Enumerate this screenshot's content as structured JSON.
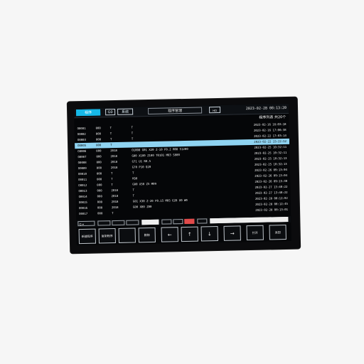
{
  "titlebar": {
    "tab_active": "程序",
    "tab_1": "G0",
    "tab_2": "系统",
    "title": "程序管理",
    "button": "HD",
    "clock": "2023-02-28 08:13:20"
  },
  "subheader": "程序列表  共20个",
  "rows": [
    {
      "c1": "O0001",
      "c2": "000",
      "c3": "T",
      "c4": "T",
      "c5": "2023-02-16 16:03:18",
      "selected": false
    },
    {
      "c1": "O0002",
      "c2": "000",
      "c3": "T",
      "c4": "T",
      "c5": "2023-02-16 17:06:38",
      "selected": false
    },
    {
      "c1": "O0003",
      "c2": "000",
      "c3": "T",
      "c4": "T",
      "c5": "2023-02-22 17:03:14",
      "selected": false
    },
    {
      "c1": "O0005",
      "c2": "000",
      "c3": "T",
      "c4": "",
      "c5": "2023-02-22 15:22:52",
      "selected": true
    },
    {
      "c1": "O0006",
      "c2": "000",
      "c3": "2018",
      "c4": "O1000 G01 X20 Z-10 F0.2 M08 S1200",
      "c5": "2023-02-25 10:32:11",
      "selected": false
    },
    {
      "c1": "O0007",
      "c2": "000",
      "c3": "2018",
      "c4": "G00 X100 Z100 T0101 M03 S800",
      "c5": "2023-02-25 10:32:11",
      "selected": false
    },
    {
      "c1": "O0008",
      "c2": "000",
      "c3": "2018",
      "c4": "G71 U1 R0.5",
      "c5": "2023-02-25 10:32:13",
      "selected": false
    },
    {
      "c1": "O0009",
      "c2": "000",
      "c3": "2018",
      "c4": "G70 P10 Q20",
      "c5": "2023-02-25 10:32:13",
      "selected": false
    },
    {
      "c1": "O0010",
      "c2": "000",
      "c3": "T",
      "c4": "T",
      "c5": "2023-02-26 09:13:04",
      "selected": false
    },
    {
      "c1": "O0011",
      "c2": "000",
      "c3": "T",
      "c4": "M30",
      "c5": "2023-02-26 09:13:04",
      "selected": false
    },
    {
      "c1": "O0012",
      "c2": "000",
      "c3": "T",
      "c4": "G00 X50 Z5 M09",
      "c5": "2023-02-26 09:15:30",
      "selected": false
    },
    {
      "c1": "O0013",
      "c2": "000",
      "c3": "2018",
      "c4": "T",
      "c5": "2023-02-27 13:40:22",
      "selected": false
    },
    {
      "c1": "O0014",
      "c2": "000",
      "c3": "2018",
      "c4": "T",
      "c5": "2023-02-27 13:40:22",
      "selected": false
    },
    {
      "c1": "O0015",
      "c2": "000",
      "c3": "2018",
      "c4": "G01 X30 Z-20 F0.15 M05 G28 U0 W0",
      "c5": "2023-02-28 08:12:02",
      "selected": false
    },
    {
      "c1": "O0016",
      "c2": "000",
      "c3": "2018",
      "c4": "G00 X80 Z80",
      "c5": "2023-02-28 08:12:45",
      "selected": false
    },
    {
      "c1": "O0017",
      "c2": "000",
      "c3": "T",
      "c4": "",
      "c5": "2023-02-28 08:13:01",
      "selected": false
    }
  ],
  "toolbar": {
    "mini_label": "Q ▾",
    "keys": [
      {
        "label": "新建程序",
        "glyph": ""
      },
      {
        "label": "复制程序",
        "glyph": ""
      },
      {
        "label": "",
        "glyph": ""
      },
      {
        "label": "删除",
        "glyph": ""
      },
      {
        "label": "",
        "glyph": "←"
      },
      {
        "label": "",
        "glyph": "↑"
      },
      {
        "label": "",
        "glyph": "↓"
      },
      {
        "label": "",
        "glyph": "→"
      },
      {
        "label": "打开",
        "glyph": ""
      },
      {
        "label": "返回",
        "glyph": ""
      }
    ]
  },
  "colors": {
    "accent": "#16b9e8",
    "selected_row": "#8fd3f1",
    "alert": "#e04a4a"
  }
}
